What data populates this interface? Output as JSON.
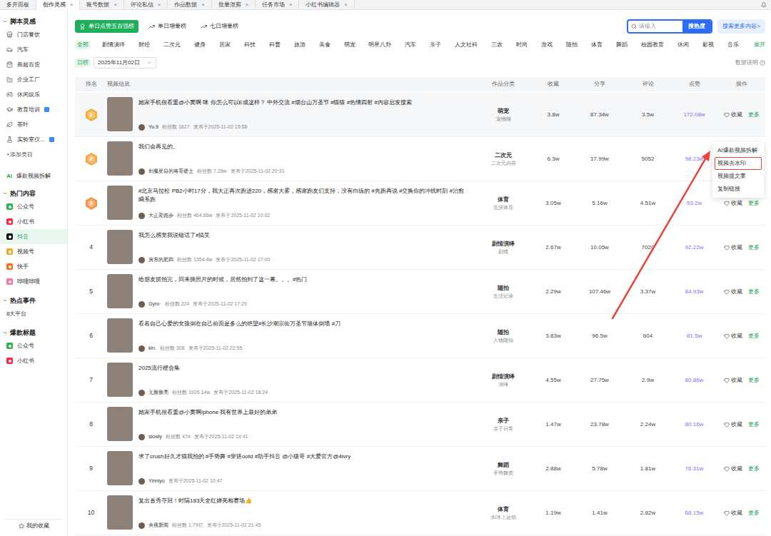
{
  "tabs": [
    {
      "label": "多开面板",
      "selected": false
    },
    {
      "label": "创作灵感",
      "selected": true,
      "close": "×"
    },
    {
      "label": "账号数据",
      "selected": false,
      "close": "×"
    },
    {
      "label": "评论私信",
      "selected": false,
      "close": "×"
    },
    {
      "label": "作品数据",
      "selected": false,
      "close": "×"
    },
    {
      "label": "批量混剪",
      "selected": false,
      "close": "×"
    },
    {
      "label": "任务市场",
      "selected": false,
      "close": "×"
    },
    {
      "label": "小红书编辑器",
      "selected": false,
      "close": "×"
    }
  ],
  "sidebar": {
    "script_title": "脚本灵感",
    "script_items": [
      {
        "label": "门店餐饮",
        "badge": false,
        "selected": false
      },
      {
        "label": "汽车",
        "badge": false,
        "selected": false
      },
      {
        "label": "商超百货",
        "badge": false,
        "selected": false
      },
      {
        "label": "企业工厂",
        "badge": false,
        "selected": false
      },
      {
        "label": "休闲娱乐",
        "badge": false,
        "selected": false
      },
      {
        "label": "教育培训",
        "badge": true,
        "selected": false
      },
      {
        "label": "茶叶",
        "badge": false,
        "selected": false
      },
      {
        "label": "实验室仪...",
        "badge": true,
        "selected": false
      }
    ],
    "add_label": "+添加类目",
    "ai_link": {
      "badge": "Ai",
      "label": "爆款视频拆解",
      "selected": false
    },
    "hot_title": "热门内容",
    "hot_items": [
      {
        "label": "公众号",
        "color": "#2bb24c",
        "selected": false
      },
      {
        "label": "小红书",
        "color": "#ff2442",
        "selected": false
      },
      {
        "label": "抖音",
        "color": "#111111",
        "selected": true
      },
      {
        "label": "视频号",
        "color": "#f5a623",
        "selected": false
      },
      {
        "label": "快手",
        "color": "#ff6a1a",
        "selected": false
      },
      {
        "label": "哔哩哔哩",
        "color": "#fb7299",
        "selected": false
      }
    ],
    "events_title": "热点事件",
    "events_items": [
      {
        "label": "8大平台",
        "selected": false
      }
    ],
    "titles_title": "爆款标题",
    "titles_items": [
      {
        "label": "公众号",
        "color": "#2bb24c",
        "selected": false
      },
      {
        "label": "小红书",
        "color": "#ff2442",
        "selected": false
      }
    ],
    "favorites": "我的收藏"
  },
  "rankings": [
    {
      "label": "单日点赞五百强榜",
      "selected": true
    },
    {
      "label": "单日增量榜",
      "selected": false
    },
    {
      "label": "七日增量榜",
      "selected": false
    }
  ],
  "search": {
    "placeholder": "请输入",
    "button": "搜热度"
  },
  "more_button": "搜索更多内容>",
  "categories": [
    {
      "label": "全部",
      "selected": true
    },
    {
      "label": "剧情演绎",
      "selected": false
    },
    {
      "label": "财经",
      "selected": false
    },
    {
      "label": "二次元",
      "selected": false
    },
    {
      "label": "健身",
      "selected": false
    },
    {
      "label": "居家",
      "selected": false
    },
    {
      "label": "科技",
      "selected": false
    },
    {
      "label": "科普",
      "selected": false
    },
    {
      "label": "旅游",
      "selected": false
    },
    {
      "label": "美食",
      "selected": false
    },
    {
      "label": "萌宠",
      "selected": false
    },
    {
      "label": "明星八卦",
      "selected": false
    },
    {
      "label": "汽车",
      "selected": false
    },
    {
      "label": "亲子",
      "selected": false
    },
    {
      "label": "人文社科",
      "selected": false
    },
    {
      "label": "三农",
      "selected": false
    },
    {
      "label": "时尚",
      "selected": false
    },
    {
      "label": "游戏",
      "selected": false
    },
    {
      "label": "随拍",
      "selected": false
    },
    {
      "label": "体育",
      "selected": false
    },
    {
      "label": "舞蹈",
      "selected": false
    },
    {
      "label": "校园教育",
      "selected": false
    },
    {
      "label": "休闲",
      "selected": false
    },
    {
      "label": "影视",
      "selected": false
    },
    {
      "label": "音乐",
      "selected": false
    }
  ],
  "expand": "展开",
  "date": {
    "label": "日榜",
    "value": "2025年11月02日"
  },
  "data_note": "数据说明",
  "table": {
    "columns": [
      "排名",
      "视频信息",
      "作品分类",
      "收藏",
      "分享",
      "评论",
      "点赞",
      "操作"
    ],
    "fans_label": "粉丝数",
    "actions": {
      "favorite": "收藏",
      "more": "更多"
    },
    "rows": [
      {
        "rank": "1",
        "kind": "medal",
        "color": "#f4b03e",
        "title": "她家手机很看重@小黄啊 咪 你怎么可以E成这样？ 中外交流 #烟台山万圣节 #猫猫 #热情四射 #内容启发搜索",
        "author": "Yu.9",
        "fans": "1627",
        "published": "发布于2025-11-02 15:58",
        "category": "萌宠",
        "subcategory": "宠物猫",
        "collect": "3.8w",
        "share": "87.34w",
        "comment": "3.5w",
        "like": "172.08w",
        "menu_open": true
      },
      {
        "rank": "2",
        "kind": "medal",
        "color": "#f6a94a",
        "title": "我们会再见的。",
        "author": "剑魔星目的将哥硬士",
        "fans": "7.28w",
        "published": "发布于2025-11-02 20:31",
        "category": "二次元",
        "subcategory": "二次元内容",
        "collect": "6.3w",
        "share": "17.99w",
        "comment": "5052",
        "like": "98.23w",
        "menu_open": false
      },
      {
        "rank": "3",
        "kind": "medal",
        "color": "#f29a4c",
        "title": "#北京马拉松 PB2小时17分，我大正再次跑进220，感谢大雾，感谢跑友们支持，没有白练的 #先跑再说 #交换你的冲线时刻 #治愈瞬系跑",
        "author": "大正爱跑步",
        "fans": "464.66w",
        "published": "发布于2025-11-02 10:02",
        "category": "体育",
        "subcategory": "竞技体育",
        "collect": "3.05w",
        "share": "5.16w",
        "comment": "4.51w",
        "like": "93.2w",
        "menu_open": false
      },
      {
        "rank": "4",
        "kind": "plain",
        "title": "我怎么感觉我说错话了#搞笑",
        "author": "房东的肥四",
        "fans": "1354.4w",
        "published": "发布于2025-11-02 17:00",
        "category": "剧情演绎",
        "subcategory": "剧情",
        "collect": "2.67w",
        "share": "10.05w",
        "comment": "7020",
        "like": "92.22w",
        "menu_open": false
      },
      {
        "rank": "5",
        "kind": "plain",
        "title": "给朋友抓拍完，回来挑照片的时候，居然拍到了这一幕。。。#热门",
        "author": "Gyro·",
        "fans": "224",
        "published": "发布于2025-11-02 17:29",
        "category": "随拍",
        "subcategory": "生活记录",
        "collect": "2.29w",
        "share": "107.46w",
        "comment": "3.37w",
        "like": "84.93w",
        "menu_open": false
      },
      {
        "rank": "6",
        "kind": "plain",
        "title": "看着自己心爱的女孩倒在自己前面是多么的绝望#长沙潮宗街万圣节墙体倒塌 #刀",
        "author": "kin.",
        "fans": "308",
        "published": "发布于2025-11-02 22:55",
        "category": "随拍",
        "subcategory": "人物随拍",
        "collect": "3.83w",
        "share": "96.5w",
        "comment": "604",
        "like": "81.5w",
        "menu_open": false
      },
      {
        "rank": "7",
        "kind": "plain",
        "title": "2025流行梗合集",
        "author": "无脸脸亮",
        "fans": "1926.14w",
        "published": "发布于2025-11-02 18:24",
        "category": "剧情演绎",
        "subcategory": "演绎",
        "collect": "4.55w",
        "share": "27.75w",
        "comment": "2.9w",
        "like": "80.86w",
        "menu_open": false
      },
      {
        "rank": "8",
        "kind": "plain",
        "title": "她家手机很看重@小黄啊iphone 我有世界上最好的弟弟",
        "author": "slowly",
        "fans": "474",
        "published": "发布于2025-11-02 19:41",
        "category": "亲子",
        "subcategory": "亲子日常",
        "collect": "1.47w",
        "share": "23.78w",
        "comment": "2.24w",
        "like": "80.16w",
        "menu_open": false
      },
      {
        "rank": "9",
        "kind": "plain",
        "title": "求了crush好久才猫我拍的 #手势舞 #穿搭ootd #助手抖音 @小猿哥 #大爱官方@4ivry",
        "author": "Yinniyo",
        "published": "发布于2025-11-02 10:47",
        "category": "舞蹈",
        "subcategory": "手势舞类",
        "collect": "2.88w",
        "share": "5.78w",
        "comment": "1.81w",
        "like": "76.31w",
        "menu_open": false
      },
      {
        "rank": "10",
        "kind": "plain",
        "title": "复出首秀夺冠！时隔183天全红婵亮相赛场👍",
        "author": "央视新闻",
        "fans": "1.79亿",
        "published": "发布于2025-11-02 21:45",
        "category": "体育",
        "subcategory": "水/冰上运动",
        "collect": "1.19w",
        "share": "1.41w",
        "comment": "2.82w",
        "like": "68.15w",
        "menu_open": false
      }
    ]
  },
  "menu": {
    "highlight_color": "#e8453c",
    "items": [
      {
        "label": "AI爆款视频拆解",
        "highlighted": false
      },
      {
        "label": "视频去水印",
        "highlighted": true
      },
      {
        "label": "视频提文案",
        "highlighted": false
      },
      {
        "label": "复制链接",
        "highlighted": false
      }
    ]
  }
}
